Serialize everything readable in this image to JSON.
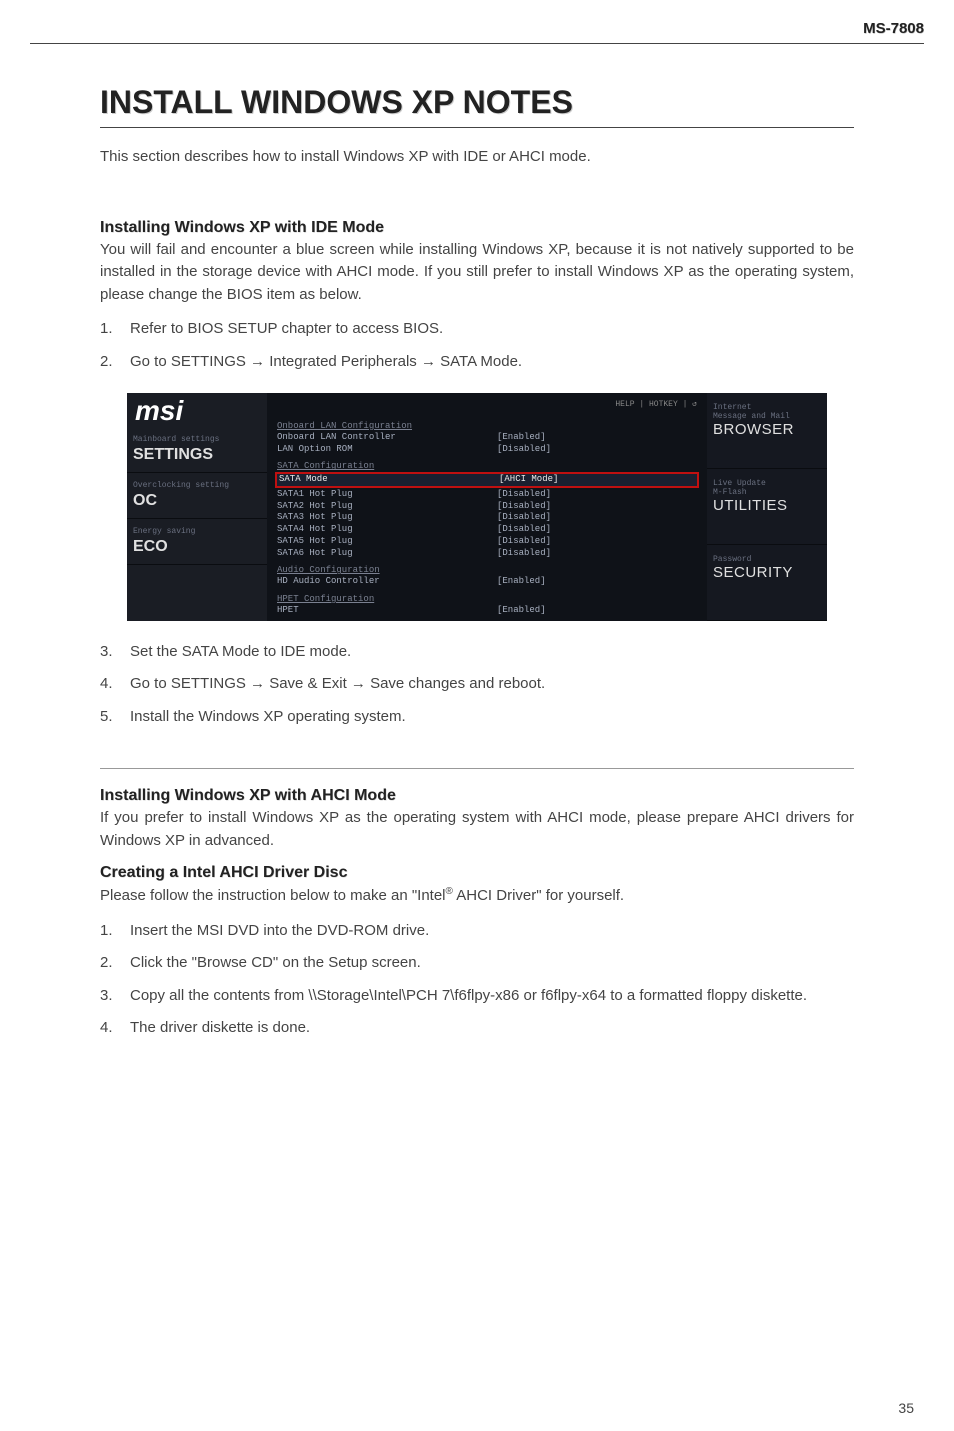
{
  "header": {
    "model": "MS-7808"
  },
  "main_title": "INSTALL WINDOWS XP NOTES",
  "intro": "This section describes how to install Windows XP with IDE or AHCI mode.",
  "section_ide": {
    "title": "Installing Windows XP with IDE Mode",
    "body": "You will fail and encounter a blue screen while installing Windows XP, because it is not natively supported to be installed in the storage device with AHCI mode. If you still prefer to install Windows XP as the operating system, please change the BIOS item as below.",
    "steps_before": [
      "Refer to BIOS SETUP chapter to access BIOS.",
      "Go to SETTINGS → Integrated Peripherals → SATA Mode."
    ],
    "steps_after": [
      "Set the SATA Mode to IDE mode.",
      "Go to SETTINGS → Save & Exit → Save changes and reboot.",
      "Install the Windows XP operating system."
    ]
  },
  "section_ahci": {
    "title": "Installing Windows XP with AHCI Mode",
    "body": "If you prefer to install Windows XP as the operating system with AHCI mode, please prepare AHCI drivers for Windows XP in advanced.",
    "subtitle": "Creating a Intel AHCI Driver Disc",
    "subbody_prefix": "Please follow the instruction below to make an \"Intel",
    "subbody_suffix": " AHCI Driver\" for yourself.",
    "steps": [
      "Insert the MSI DVD into the DVD-ROM drive.",
      "Click the \"Browse CD\" on the Setup screen.",
      "Copy all the contents from \\\\Storage\\Intel\\PCH 7\\f6flpy-x86 or f6flpy-x64 to a formatted floppy diskette.",
      "The driver diskette is done."
    ]
  },
  "bios": {
    "top_right": "HELP | HOTKEY | ↺",
    "left_nav": [
      {
        "small": "Mainboard settings",
        "big": "SETTINGS"
      },
      {
        "small": "Overclocking setting",
        "big": "OC"
      },
      {
        "small": "Energy saving",
        "big": "ECO"
      }
    ],
    "right_nav": [
      {
        "small": "Internet",
        "small2": "Message and Mail",
        "big": "BROWSER"
      },
      {
        "small": "Live Update",
        "small2": "M-Flash",
        "big": "UTILITIES"
      },
      {
        "small": "Password",
        "small2": "",
        "big": "SECURITY"
      }
    ],
    "sections": [
      {
        "label": "Onboard LAN Configuration",
        "rows": [
          {
            "key": "Onboard LAN Controller",
            "val": "[Enabled]"
          },
          {
            "key": "LAN Option ROM",
            "val": "[Disabled]"
          }
        ]
      },
      {
        "label": "SATA Configuration",
        "rows": [
          {
            "key": "SATA Mode",
            "val": "[AHCI Mode]",
            "hl": true
          },
          {
            "key": "SATA1 Hot Plug",
            "val": "[Disabled]"
          },
          {
            "key": "SATA2 Hot Plug",
            "val": "[Disabled]"
          },
          {
            "key": "SATA3 Hot Plug",
            "val": "[Disabled]"
          },
          {
            "key": "SATA4 Hot Plug",
            "val": "[Disabled]"
          },
          {
            "key": "SATA5 Hot Plug",
            "val": "[Disabled]"
          },
          {
            "key": "SATA6 Hot Plug",
            "val": "[Disabled]"
          }
        ]
      },
      {
        "label": "Audio Configuration",
        "rows": [
          {
            "key": "HD Audio Controller",
            "val": "[Enabled]"
          }
        ]
      },
      {
        "label": "HPET Configuration",
        "rows": [
          {
            "key": "HPET",
            "val": "[Enabled]"
          }
        ]
      }
    ]
  },
  "page_number": "35",
  "msi_logo": "msi"
}
